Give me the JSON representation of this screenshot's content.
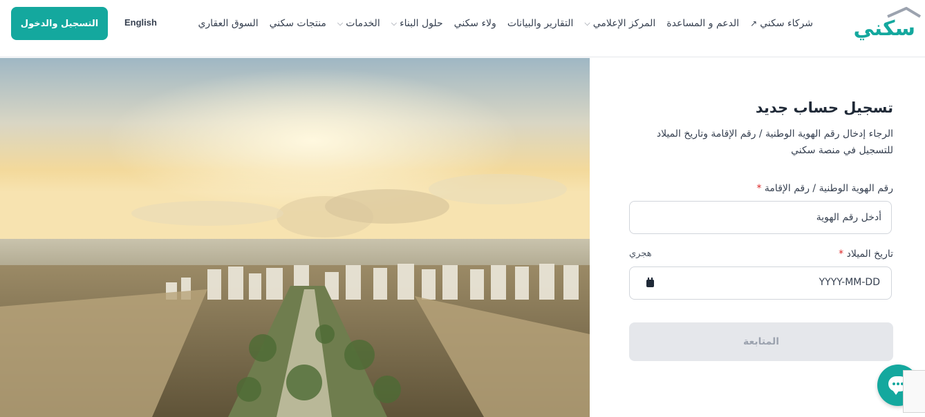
{
  "header": {
    "logo_text": "سكني",
    "nav": [
      {
        "label": "السوق العقاري",
        "dropdown": false,
        "external": false
      },
      {
        "label": "منتجات سكني",
        "dropdown": false,
        "external": false
      },
      {
        "label": "الخدمات",
        "dropdown": true,
        "external": false
      },
      {
        "label": "حلول البناء",
        "dropdown": true,
        "external": false
      },
      {
        "label": "ولاء سكني",
        "dropdown": false,
        "external": false
      },
      {
        "label": "التقارير والبيانات",
        "dropdown": false,
        "external": false
      },
      {
        "label": "المركز الإعلامي",
        "dropdown": true,
        "external": false
      },
      {
        "label": "الدعم و المساعدة",
        "dropdown": false,
        "external": false
      },
      {
        "label": "شركاء سكني",
        "dropdown": false,
        "external": true
      }
    ],
    "language_label": "English",
    "login_button": "التسجيل والدخول"
  },
  "form": {
    "title": "تسجيل حساب جديد",
    "description": "الرجاء إدخال رقم الهوية الوطنية / رقم الإقامة وتاريخ الميلاد للتسجيل في منصة سكني",
    "id_label": "رقم الهوية الوطنية / رقم الإقامة",
    "id_placeholder": "أدخل رقم الهوية",
    "dob_label": "تاريخ الميلاد",
    "required_mark": "*",
    "calendar_toggle": "هجري",
    "dob_placeholder": "YYYY-MM-DD",
    "submit_label": "المتابعة"
  },
  "colors": {
    "brand": "#14a89e",
    "required": "#dc2626",
    "disabled_button": "#e5e7eb"
  },
  "icons": {
    "chat": "chat-bubble-icon",
    "calendar": "calendar-icon",
    "external": "external-link-icon",
    "dropdown": "chevron-down-icon"
  }
}
